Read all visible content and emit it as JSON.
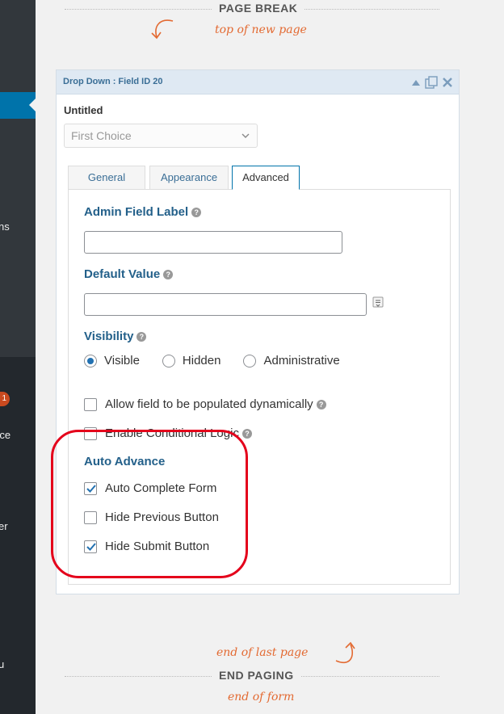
{
  "sidebar": {
    "fragments": [
      "ns",
      "1",
      "rce",
      "er",
      "u"
    ]
  },
  "page_break": {
    "title": "PAGE BREAK",
    "note": "top of new page"
  },
  "end_paging": {
    "title": "END PAGING",
    "note_above": "end of last page",
    "note_below": "end of form"
  },
  "field": {
    "header_title": "Drop Down : Field ID 20",
    "preview_label": "Untitled",
    "preview_value": "First Choice",
    "tabs": [
      {
        "label": "General"
      },
      {
        "label": "Appearance"
      },
      {
        "label": "Advanced"
      }
    ],
    "active_tab": "Advanced",
    "admin_label": {
      "title": "Admin Field Label",
      "value": ""
    },
    "default_value": {
      "title": "Default Value",
      "value": ""
    },
    "visibility": {
      "title": "Visibility",
      "options": [
        "Visible",
        "Hidden",
        "Administrative"
      ],
      "selected": "Visible"
    },
    "allow_dynamic": {
      "label": "Allow field to be populated dynamically",
      "checked": false
    },
    "conditional_logic": {
      "label": "Enable Conditional Logic",
      "checked": false
    },
    "auto_advance": {
      "title": "Auto Advance",
      "options": [
        {
          "label": "Auto Complete Form",
          "checked": true
        },
        {
          "label": "Hide Previous Button",
          "checked": false
        },
        {
          "label": "Hide Submit Button",
          "checked": true
        }
      ]
    }
  },
  "colors": {
    "sidebar": "#23282d",
    "sidebar_active": "#0073aa",
    "accent_handwriting": "#e36a32",
    "highlight_ring": "#e4001b",
    "setting_title": "#23608a"
  }
}
